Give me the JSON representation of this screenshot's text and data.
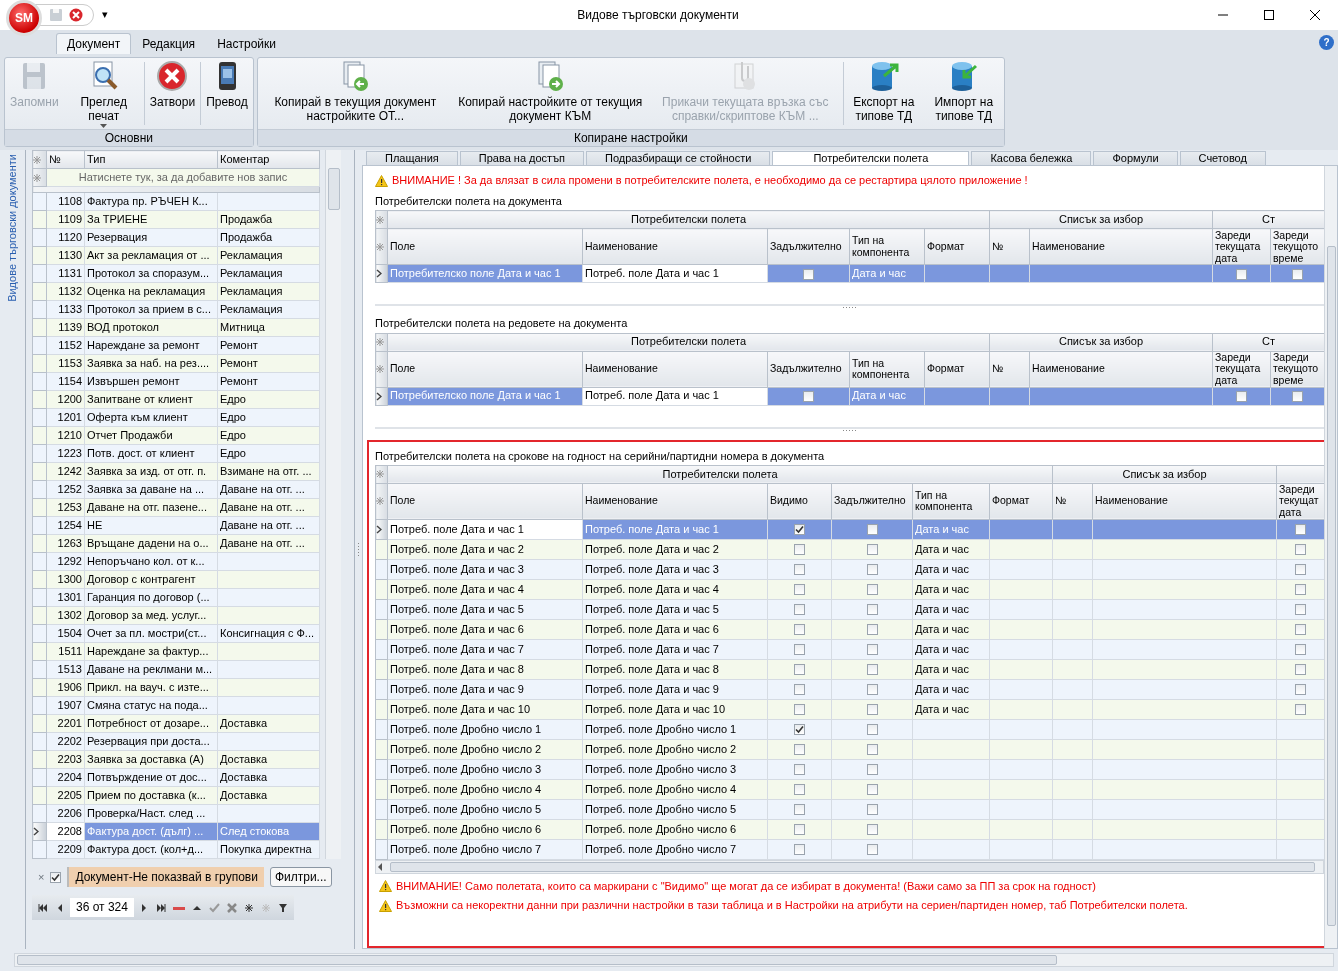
{
  "window": {
    "title": "Видове търговски документи",
    "app_logo": "SM",
    "quick_access": [
      {
        "kind": "save",
        "disabled": true
      },
      {
        "kind": "close",
        "disabled": false
      }
    ],
    "quick_access_menu": "▾"
  },
  "ribbon": {
    "tabs": [
      {
        "label": "Документ",
        "selected": true
      },
      {
        "label": "Редакция",
        "selected": false
      },
      {
        "label": "Настройки",
        "selected": false
      }
    ],
    "help": "?",
    "groups": [
      {
        "label": "Основни",
        "buttons": [
          {
            "label": "Запомни",
            "kind": "save",
            "disabled": true,
            "dropdown": false
          },
          {
            "label": "Преглед печат",
            "kind": "preview",
            "disabled": false,
            "dropdown": true
          },
          {
            "label": "Затвори",
            "kind": "close",
            "disabled": false,
            "dropdown": false
          },
          {
            "label": "Превод",
            "kind": "translate",
            "disabled": false,
            "dropdown": false
          }
        ]
      },
      {
        "label": "Копиране настройки",
        "buttons": [
          {
            "label": "Копирай в текущия документ настройките ОТ...",
            "kind": "copyfrom",
            "disabled": false,
            "dropdown": false
          },
          {
            "label": "Копирай настройките от текущия документ КЪМ",
            "kind": "copyto",
            "disabled": false,
            "dropdown": false
          },
          {
            "label": "Прикачи текущата връзка със справки/скриптове КЪМ ...",
            "kind": "attach",
            "disabled": true,
            "dropdown": false
          },
          {
            "label": "Експорт на типове ТД",
            "kind": "export",
            "disabled": false,
            "dropdown": false
          },
          {
            "label": "Импорт на типове ТД",
            "kind": "import",
            "disabled": false,
            "dropdown": false
          }
        ]
      }
    ]
  },
  "left_panel": {
    "side_tab": "Видове търговски документи",
    "columns": [
      "№",
      "Тип",
      "Коментар"
    ],
    "new_row_hint": "Натиснете тук, за да добавите нов запис",
    "rows": [
      {
        "number": "1108",
        "type": "Фактура пр. РЪЧЕН К...",
        "comment": null,
        "selected": false
      },
      {
        "number": "1109",
        "type": "За ТРИЕНЕ",
        "comment": "Продажба",
        "selected": false
      },
      {
        "number": "1120",
        "type": "Резервация",
        "comment": "Продажба",
        "selected": false
      },
      {
        "number": "1130",
        "type": "Акт за рекламация от ...",
        "comment": "Рекламация",
        "selected": false
      },
      {
        "number": "1131",
        "type": "Протокол за споразум...",
        "comment": "Рекламация",
        "selected": false
      },
      {
        "number": "1132",
        "type": "Оценка на рекламация",
        "comment": "Рекламация",
        "selected": false
      },
      {
        "number": "1133",
        "type": "Протокол за прием в с...",
        "comment": "Рекламация",
        "selected": false
      },
      {
        "number": "1139",
        "type": "ВОД протокол",
        "comment": "Митница",
        "selected": false
      },
      {
        "number": "1152",
        "type": "Нареждане за ремонт",
        "comment": "Ремонт",
        "selected": false
      },
      {
        "number": "1153",
        "type": "Заявка за наб. на рез....",
        "comment": "Ремонт",
        "selected": false
      },
      {
        "number": "1154",
        "type": "Извършен ремонт",
        "comment": "Ремонт",
        "selected": false
      },
      {
        "number": "1200",
        "type": "Запитване от клиент",
        "comment": "Едро",
        "selected": false
      },
      {
        "number": "1201",
        "type": "Оферта към клиент",
        "comment": "Едро",
        "selected": false
      },
      {
        "number": "1210",
        "type": "Отчет Продажби",
        "comment": "Едро",
        "selected": false
      },
      {
        "number": "1223",
        "type": "Потв. дост. от клиент",
        "comment": "Едро",
        "selected": false
      },
      {
        "number": "1242",
        "type": "Заявка за изд. от отг. п.",
        "comment": "Взимане на отг. ...",
        "selected": false
      },
      {
        "number": "1252",
        "type": "Заявка за даване на ...",
        "comment": "Даване на отг. ...",
        "selected": false
      },
      {
        "number": "1253",
        "type": "Даване на отг. пазене...",
        "comment": "Даване на отг. ...",
        "selected": false
      },
      {
        "number": "1254",
        "type": "НЕ",
        "comment": "Даване на отг. ...",
        "selected": false
      },
      {
        "number": "1263",
        "type": "Връщане дадени на о...",
        "comment": "Даване на отг. ...",
        "selected": false
      },
      {
        "number": "1292",
        "type": "Непоръчано кол. от к...",
        "comment": null,
        "selected": false
      },
      {
        "number": "1300",
        "type": "Договор с контрагент",
        "comment": null,
        "selected": false
      },
      {
        "number": "1301",
        "type": "Гаранция по договор (...",
        "comment": null,
        "selected": false
      },
      {
        "number": "1302",
        "type": "Договор за мед. услуг...",
        "comment": null,
        "selected": false
      },
      {
        "number": "1504",
        "type": "Очет за пл. мостри(ст...",
        "comment": "Консигнация с Ф...",
        "selected": false
      },
      {
        "number": "1511",
        "type": "Нареждане за фактур...",
        "comment": null,
        "selected": false
      },
      {
        "number": "1513",
        "type": "Даване на реклмани м...",
        "comment": null,
        "selected": false
      },
      {
        "number": "1906",
        "type": "Прикл. на вауч. с изте...",
        "comment": null,
        "selected": false
      },
      {
        "number": "1907",
        "type": "Смяна статус на пода...",
        "comment": null,
        "selected": false
      },
      {
        "number": "2201",
        "type": "Потребност от дозаре...",
        "comment": "Доставка",
        "selected": false
      },
      {
        "number": "2202",
        "type": "Резервация при доста...",
        "comment": null,
        "selected": false
      },
      {
        "number": "2203",
        "type": "Заявка за доставка (А)",
        "comment": "Доставка",
        "selected": false
      },
      {
        "number": "2204",
        "type": "Потвърждение от дос...",
        "comment": "Доставка",
        "selected": false
      },
      {
        "number": "2205",
        "type": "Прием по доставка (к...",
        "comment": "Доставка",
        "selected": false
      },
      {
        "number": "2206",
        "type": "Проверка/Наст. след ...",
        "comment": null,
        "selected": false
      },
      {
        "number": "2208",
        "type": "Фактура дост. (дълг) ...",
        "comment": "След стокова",
        "selected": true
      },
      {
        "number": "2209",
        "type": "Фактура дост. (кол+д...",
        "comment": "Покупка директна",
        "selected": false
      }
    ],
    "filter": {
      "clear": "×",
      "enabled": true,
      "text": "Документ-Не показвай в групови",
      "button": "Филтри..."
    },
    "navigator": {
      "position": "36 от 324"
    }
  },
  "right_panel": {
    "tabs": [
      {
        "label": "Плащания",
        "selected": false
      },
      {
        "label": "Права на достъп",
        "selected": false
      },
      {
        "label": "Подразбиращи се стойности",
        "selected": false
      },
      {
        "label": "Потребителски полета",
        "selected": true
      },
      {
        "label": "Касова бележка",
        "selected": false
      },
      {
        "label": "Формули",
        "selected": false
      },
      {
        "label": "Счетовод",
        "selected": false
      }
    ],
    "warning": "ВНИМАНИЕ ! За да влязат в сила промени в потребителските полета,  е необходимо да се рестартира цялото приложение !",
    "grids": [
      {
        "caption": "Потребителски полета на документа",
        "highlighted": false,
        "column_groups": [
          {
            "label": "Потребителски полета"
          },
          {
            "label": "Списък за избор"
          },
          {
            "label": "Ст"
          }
        ],
        "columns": [
          {
            "label": "Поле",
            "kind": "text"
          },
          {
            "label": "Наименование",
            "kind": "text"
          },
          {
            "label": "Задължително",
            "kind": "check"
          },
          {
            "label": "Тип на компонента",
            "kind": "text"
          },
          {
            "label": "Формат",
            "kind": "text"
          },
          {
            "label": "№",
            "kind": "text"
          },
          {
            "label": "Наименование",
            "kind": "text"
          },
          {
            "label": "Зареди текущата дата",
            "kind": "check"
          },
          {
            "label": "Зареди текущото време",
            "kind": "check"
          }
        ],
        "rows": [
          {
            "selected": true,
            "cells": [
              "Потребителско поле Дата и час 1",
              "Потреб. поле Дата и час 1",
              false,
              "Дата и час",
              null,
              null,
              null,
              false,
              false
            ]
          }
        ]
      },
      {
        "caption": "Потребителски полета на редовете на документа",
        "highlighted": false,
        "column_groups": [
          {
            "label": "Потребителски полета"
          },
          {
            "label": "Списък за избор"
          },
          {
            "label": "Ст"
          }
        ],
        "columns": [
          {
            "label": "Поле",
            "kind": "text"
          },
          {
            "label": "Наименование",
            "kind": "text"
          },
          {
            "label": "Задължително",
            "kind": "check"
          },
          {
            "label": "Тип на компонента",
            "kind": "text"
          },
          {
            "label": "Формат",
            "kind": "text"
          },
          {
            "label": "№",
            "kind": "text"
          },
          {
            "label": "Наименование",
            "kind": "text"
          },
          {
            "label": "Зареди текущата дата",
            "kind": "check"
          },
          {
            "label": "Зареди текущото време",
            "kind": "check"
          }
        ],
        "rows": [
          {
            "selected": true,
            "cells": [
              "Потребителско поле Дата и час 1",
              "Потреб. поле Дата и час 1",
              false,
              "Дата и час",
              null,
              null,
              null,
              false,
              false
            ]
          }
        ]
      },
      {
        "caption": "Потребителски полета на срокове на годност на серийни/партидни номера в документа",
        "highlighted": true,
        "column_groups": [
          {
            "label": "Потребителски полета"
          },
          {
            "label": "Списък за избор"
          }
        ],
        "columns": [
          {
            "label": "Поле",
            "kind": "text"
          },
          {
            "label": "Наименование",
            "kind": "text"
          },
          {
            "label": "Видимо",
            "kind": "check"
          },
          {
            "label": "Задължително",
            "kind": "check"
          },
          {
            "label": "Тип на компонента",
            "kind": "text"
          },
          {
            "label": "Формат",
            "kind": "text"
          },
          {
            "label": "№",
            "kind": "text"
          },
          {
            "label": "Наименование",
            "kind": "text"
          },
          {
            "label": "Зареди текущат дата",
            "kind": "check"
          }
        ],
        "rows": [
          {
            "selected": true,
            "cells": [
              "Потреб. поле Дата и час 1",
              "Потреб. поле Дата и час 1",
              true,
              false,
              "Дата и час",
              null,
              null,
              null,
              false
            ]
          },
          {
            "selected": false,
            "cells": [
              "Потреб. поле Дата и час 2",
              "Потреб. поле Дата и час 2",
              false,
              false,
              "Дата и час",
              null,
              null,
              null,
              false
            ]
          },
          {
            "selected": false,
            "cells": [
              "Потреб. поле Дата и час 3",
              "Потреб. поле Дата и час 3",
              false,
              false,
              "Дата и час",
              null,
              null,
              null,
              false
            ]
          },
          {
            "selected": false,
            "cells": [
              "Потреб. поле Дата и час 4",
              "Потреб. поле Дата и час 4",
              false,
              false,
              "Дата и час",
              null,
              null,
              null,
              false
            ]
          },
          {
            "selected": false,
            "cells": [
              "Потреб. поле Дата и час 5",
              "Потреб. поле Дата и час 5",
              false,
              false,
              "Дата и час",
              null,
              null,
              null,
              false
            ]
          },
          {
            "selected": false,
            "cells": [
              "Потреб. поле Дата и час 6",
              "Потреб. поле Дата и час 6",
              false,
              false,
              "Дата и час",
              null,
              null,
              null,
              false
            ]
          },
          {
            "selected": false,
            "cells": [
              "Потреб. поле Дата и час 7",
              "Потреб. поле Дата и час 7",
              false,
              false,
              "Дата и час",
              null,
              null,
              null,
              false
            ]
          },
          {
            "selected": false,
            "cells": [
              "Потреб. поле Дата и час 8",
              "Потреб. поле Дата и час 8",
              false,
              false,
              "Дата и час",
              null,
              null,
              null,
              false
            ]
          },
          {
            "selected": false,
            "cells": [
              "Потреб. поле Дата и час 9",
              "Потреб. поле Дата и час 9",
              false,
              false,
              "Дата и час",
              null,
              null,
              null,
              false
            ]
          },
          {
            "selected": false,
            "cells": [
              "Потреб. поле Дата и час 10",
              "Потреб. поле Дата и час 10",
              false,
              false,
              "Дата и час",
              null,
              null,
              null,
              false
            ]
          },
          {
            "selected": false,
            "cells": [
              "Потреб. поле Дробно число 1",
              "Потреб. поле Дробно число 1",
              true,
              false,
              null,
              null,
              null,
              null,
              null
            ]
          },
          {
            "selected": false,
            "cells": [
              "Потреб. поле Дробно число 2",
              "Потреб. поле Дробно число 2",
              false,
              false,
              null,
              null,
              null,
              null,
              null
            ]
          },
          {
            "selected": false,
            "cells": [
              "Потреб. поле Дробно число 3",
              "Потреб. поле Дробно число 3",
              false,
              false,
              null,
              null,
              null,
              null,
              null
            ]
          },
          {
            "selected": false,
            "cells": [
              "Потреб. поле Дробно число 4",
              "Потреб. поле Дробно число 4",
              false,
              false,
              null,
              null,
              null,
              null,
              null
            ]
          },
          {
            "selected": false,
            "cells": [
              "Потреб. поле Дробно число 5",
              "Потреб. поле Дробно число 5",
              false,
              false,
              null,
              null,
              null,
              null,
              null
            ]
          },
          {
            "selected": false,
            "cells": [
              "Потреб. поле Дробно число 6",
              "Потреб. поле Дробно число 6",
              false,
              false,
              null,
              null,
              null,
              null,
              null
            ]
          },
          {
            "selected": false,
            "cells": [
              "Потреб. поле Дробно число 7",
              "Потреб. поле Дробно число 7",
              false,
              false,
              null,
              null,
              null,
              null,
              null
            ]
          }
        ]
      }
    ],
    "notes": [
      "ВНИМАНИЕ! Само полетата, които са маркирани с \"Видимо\" ще могат да се избират в документа! (Важи само за ПП за срок на годност)",
      "Възможни са некоректни данни при различни настройки в тази таблица и в Настройки на атрибути на сериен/партиден номер, таб Потребителски полета."
    ]
  }
}
